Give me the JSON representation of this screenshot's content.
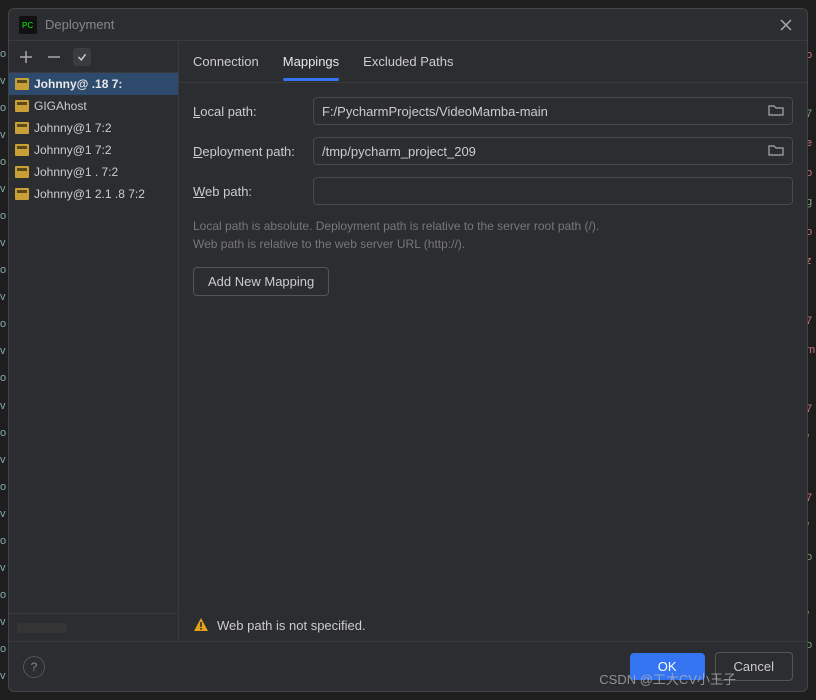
{
  "titlebar": {
    "title": "Deployment"
  },
  "sidebar": {
    "servers": [
      {
        "label": "Johnny@     .18        7:"
      },
      {
        "label": "GIGAhost"
      },
      {
        "label": "Johnny@1                  7:2"
      },
      {
        "label": "Johnny@1                  7:2"
      },
      {
        "label": "Johnny@1          .      7:2"
      },
      {
        "label": "Johnny@1   2.1   .8    7:2"
      }
    ]
  },
  "tabs": {
    "connection": "Connection",
    "mappings": "Mappings",
    "excluded": "Excluded Paths"
  },
  "form": {
    "local_path_label": "Local path:",
    "local_path_value": "F:/PycharmProjects/VideoMamba-main",
    "deployment_path_label": "Deployment path:",
    "deployment_path_value": "/tmp/pycharm_project_209",
    "web_path_label": "Web path:",
    "web_path_value": "",
    "hint_line1": "Local path is absolute. Deployment path is relative to the server root path (/).",
    "hint_line2": "Web path is relative to the web server URL (http://).",
    "add_mapping": "Add New Mapping"
  },
  "warning": {
    "text": "Web path is not specified."
  },
  "footer": {
    "ok": "OK",
    "cancel": "Cancel"
  },
  "watermark": "CSDN @工大CV小王子"
}
